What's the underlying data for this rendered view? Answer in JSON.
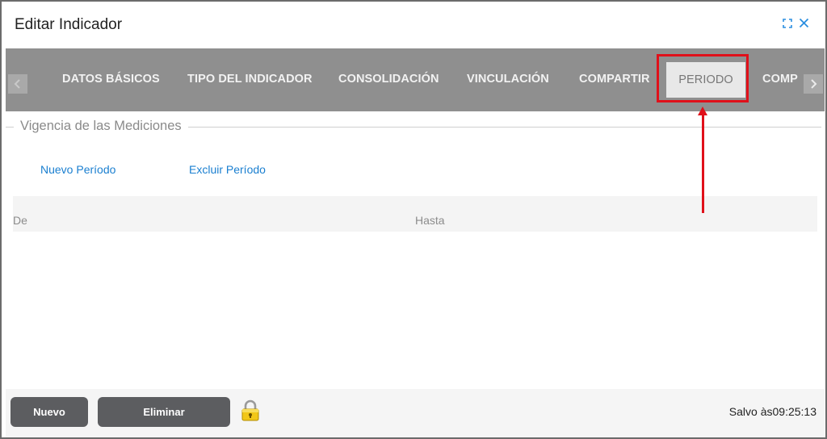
{
  "dialog": {
    "title": "Editar Indicador"
  },
  "window_icons": [
    "expand-icon",
    "close-icon"
  ],
  "tabs": [
    {
      "label": "DATOS BÁSICOS",
      "active": false
    },
    {
      "label": "TIPO DEL INDICADOR",
      "active": false
    },
    {
      "label": "CONSOLIDACIÓN",
      "active": false
    },
    {
      "label": "VINCULACIÓN",
      "active": false
    },
    {
      "label": "COMPARTIR",
      "active": false
    },
    {
      "label": "PERIODO",
      "active": true
    },
    {
      "label": "COMP",
      "active": false
    }
  ],
  "section": {
    "title": "Vigencia de las Mediciones",
    "actions": {
      "new_period": "Nuevo Período",
      "exclude_period": "Excluir Período"
    },
    "table": {
      "columns": [
        "De",
        "Hasta"
      ],
      "rows": []
    }
  },
  "footer": {
    "new_label": "Nuevo",
    "delete_label": "Eliminar",
    "status": "Salvo às09:25:13"
  },
  "colors": {
    "tabbar": "#8f8f8f",
    "active_tab": "#e8e8e8",
    "link": "#1a7fd0",
    "button": "#5c5d60",
    "annotation": "#e0101a"
  }
}
